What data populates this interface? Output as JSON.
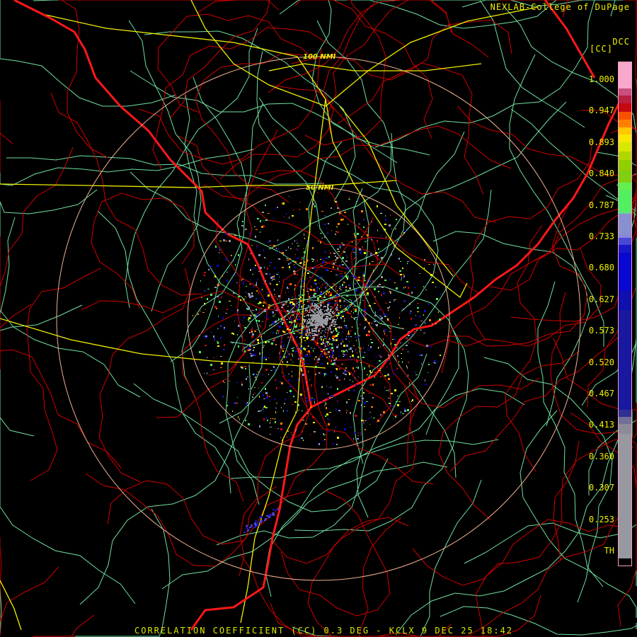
{
  "header": {
    "credit": "NEXLAB-College of DuPage",
    "product_code": "DCC",
    "unit": "[CC]"
  },
  "rings": {
    "inner_label": "50 NMI",
    "outer_label": "100 NMI"
  },
  "colorbar": {
    "labels": [
      "1.000",
      "0.947",
      "0.893",
      "0.840",
      "0.787",
      "0.733",
      "0.680",
      "0.627",
      "0.573",
      "0.520",
      "0.467",
      "0.413",
      "0.360",
      "0.307",
      "0.253",
      "TH"
    ]
  },
  "footer": "CORRELATION COEFFICIENT (CC) 0.3 DEG - KCLX 9 DEC 25 18:42",
  "colors": {
    "text": "#f0f000",
    "border": "#ff2020",
    "county": "#e00000",
    "road": "#70e0a0",
    "highway": "#f0f000",
    "ring": "#f0b090"
  }
}
